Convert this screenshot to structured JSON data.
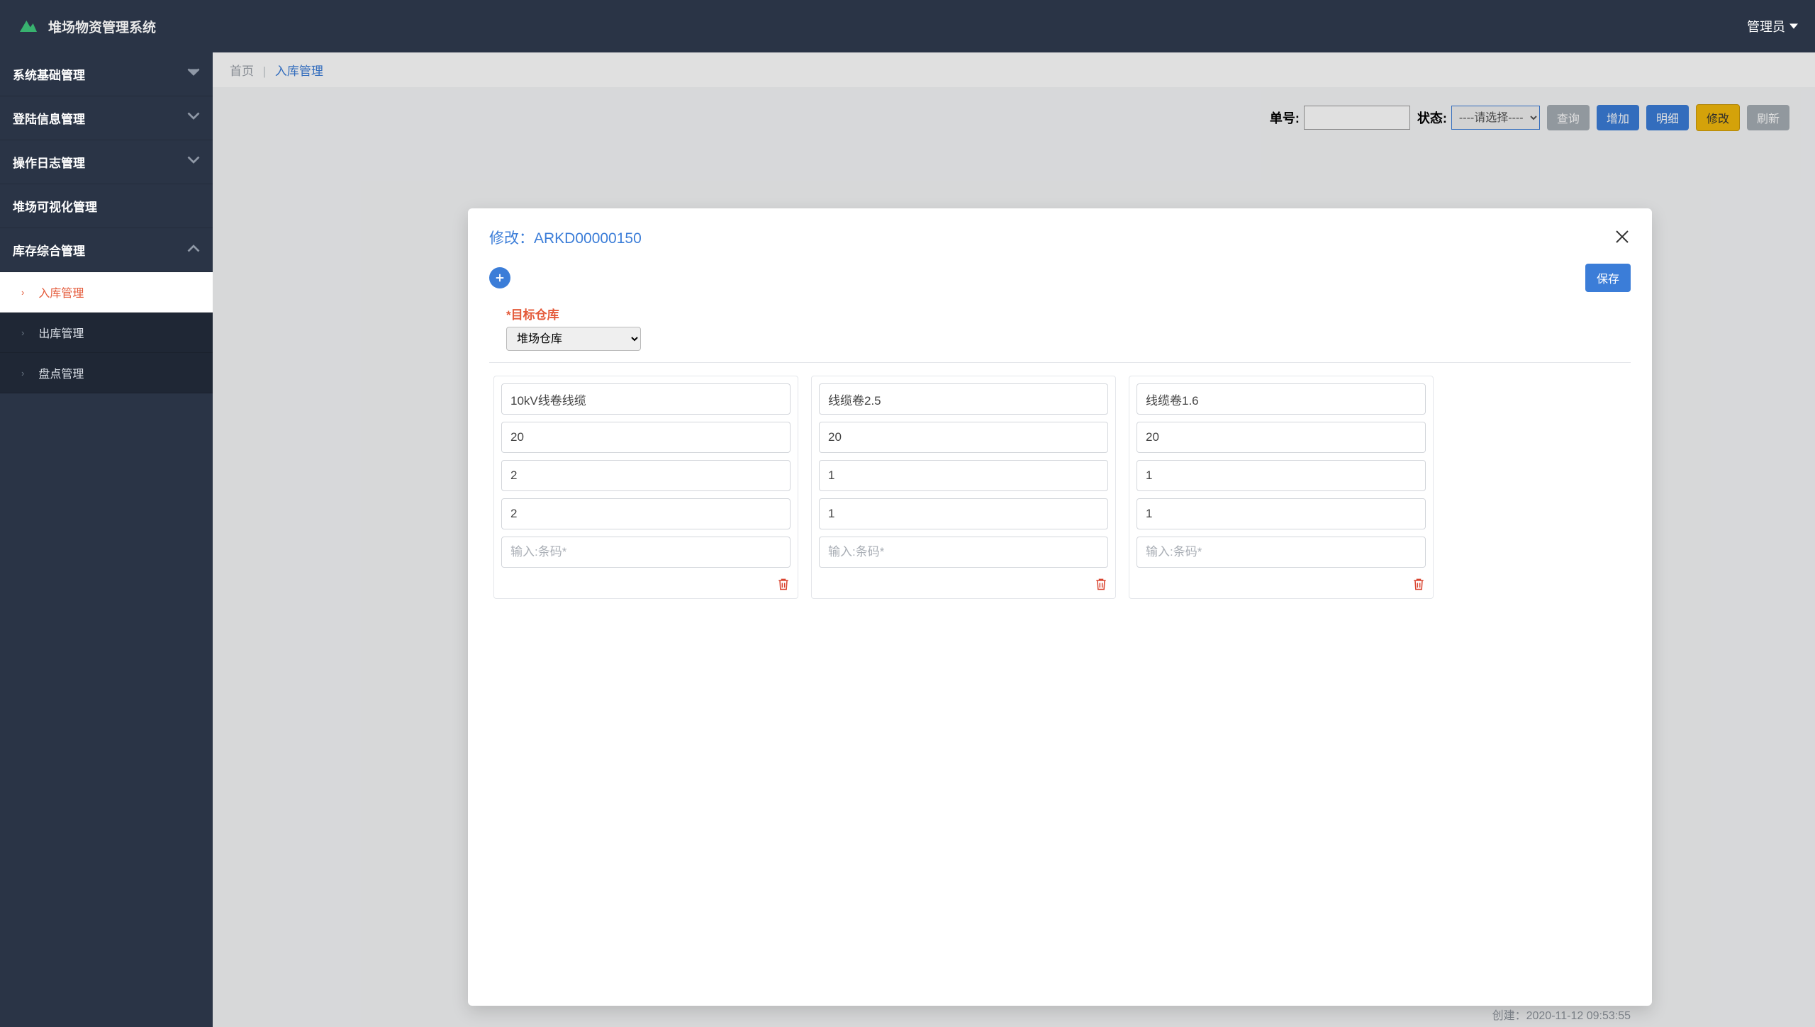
{
  "app": {
    "title": "堆场物资管理系统"
  },
  "user": {
    "name": "管理员"
  },
  "sidebar": {
    "groups": [
      {
        "label": "系统基础管理",
        "expanded": false
      },
      {
        "label": "登陆信息管理",
        "expanded": false
      },
      {
        "label": "操作日志管理",
        "expanded": false
      },
      {
        "label": "堆场可视化管理",
        "expanded": false
      },
      {
        "label": "库存综合管理",
        "expanded": true
      }
    ],
    "inventory_items": [
      {
        "label": "入库管理",
        "active": true
      },
      {
        "label": "出库管理",
        "active": false
      },
      {
        "label": "盘点管理",
        "active": false
      }
    ]
  },
  "breadcrumb": {
    "home": "首页",
    "current": "入库管理"
  },
  "toolbar": {
    "order_label": "单号:",
    "order_value": "",
    "status_label": "状态:",
    "status_placeholder": "----请选择----",
    "buttons": {
      "query": "查询",
      "add": "增加",
      "detail": "明细",
      "edit": "修改",
      "refresh": "刷新"
    }
  },
  "modal": {
    "title_prefix": "修改：",
    "order_id": "ARKD00000150",
    "target_label": "*目标仓库",
    "target_value": "堆场仓库",
    "save_label": "保存",
    "barcode_placeholder": "输入:条码*",
    "cards": [
      {
        "name": "10kV线卷线缆",
        "qty": "20",
        "a": "2",
        "b": "2",
        "barcode": ""
      },
      {
        "name": "线缆卷2.5",
        "qty": "20",
        "a": "1",
        "b": "1",
        "barcode": ""
      },
      {
        "name": "线缆卷1.6",
        "qty": "20",
        "a": "1",
        "b": "1",
        "barcode": ""
      }
    ]
  },
  "peek_footer": "创建：2020-11-12 09:53:55"
}
